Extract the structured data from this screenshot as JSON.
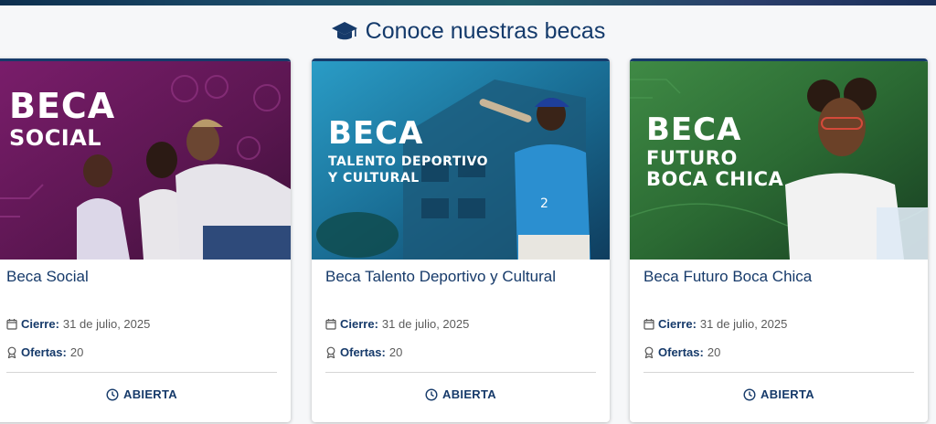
{
  "section": {
    "title": "Conoce nuestras becas",
    "icon": "graduation-cap-icon"
  },
  "cards": [
    {
      "banner": {
        "line1": "BECA",
        "line2": "SOCIAL",
        "line3": ""
      },
      "title": "Beca Social",
      "cierre_label": "Cierre:",
      "cierre_value": "31 de julio, 2025",
      "ofertas_label": "Ofertas:",
      "ofertas_value": "20",
      "status": "ABIERTA"
    },
    {
      "banner": {
        "line1": "BECA",
        "line2": "TALENTO DEPORTIVO",
        "line3": "Y CULTURAL"
      },
      "title": "Beca Talento Deportivo y Cultural",
      "cierre_label": "Cierre:",
      "cierre_value": "31 de julio, 2025",
      "ofertas_label": "Ofertas:",
      "ofertas_value": "20",
      "status": "ABIERTA"
    },
    {
      "banner": {
        "line1": "BECA",
        "line2": "FUTURO",
        "line3": "BOCA CHICA"
      },
      "title": "Beca Futuro Boca Chica",
      "cierre_label": "Cierre:",
      "cierre_value": "31 de julio, 2025",
      "ofertas_label": "Ofertas:",
      "ofertas_value": "20",
      "status": "ABIERTA"
    }
  ],
  "colors": {
    "primary": "#163a6a",
    "social_bg": "#6b1a5e",
    "deportivo_bg": "#1e7fa6",
    "futuro_bg": "#2e6b35"
  }
}
